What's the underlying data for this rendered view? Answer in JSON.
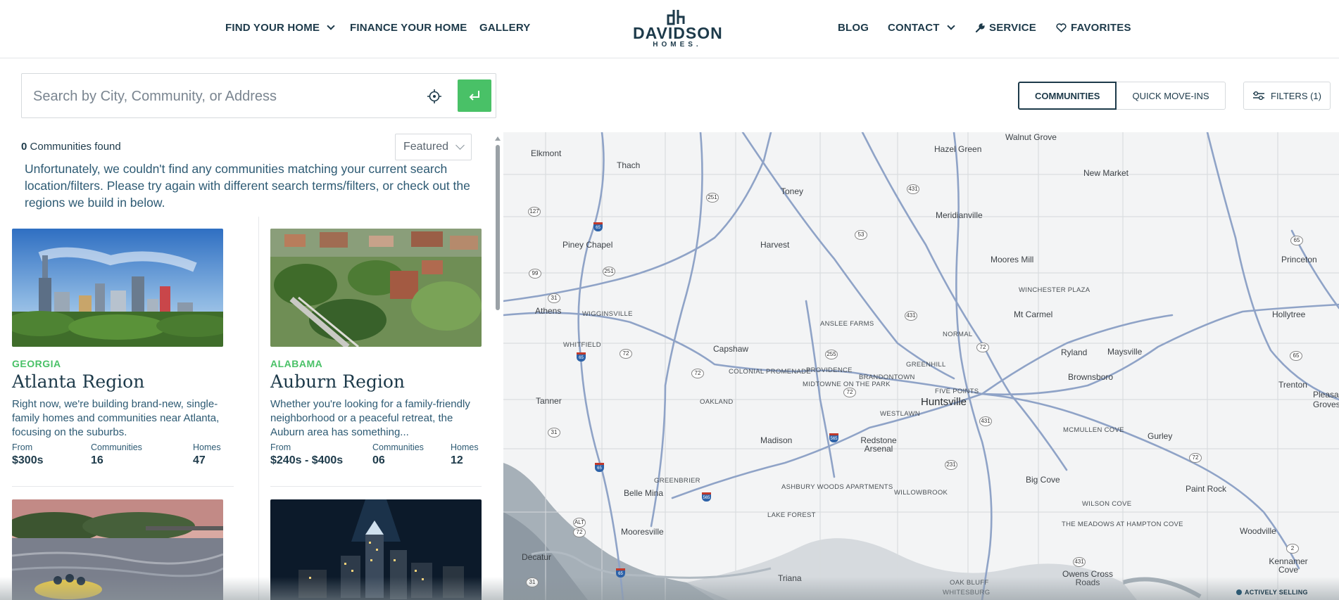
{
  "nav": {
    "left_items": [
      {
        "label": "FIND YOUR HOME",
        "has_dropdown": true
      },
      {
        "label": "FINANCE YOUR HOME",
        "has_dropdown": false
      },
      {
        "label": "GALLERY",
        "has_dropdown": false
      }
    ],
    "logo": {
      "name": "DAVIDSON",
      "sub": "HOMES."
    },
    "right_items": [
      {
        "label": "BLOG",
        "icon": ""
      },
      {
        "label": "CONTACT",
        "icon": "",
        "has_dropdown": true
      },
      {
        "label": "SERVICE",
        "icon": "wrench-icon"
      },
      {
        "label": "FAVORITES",
        "icon": "heart-icon"
      }
    ]
  },
  "search": {
    "placeholder": "Search by City, Community, or Address",
    "value": ""
  },
  "toggle": {
    "communities": "COMMUNITIES",
    "quick_move_ins": "QUICK MOVE-INS",
    "active": "communities"
  },
  "filters": {
    "label": "FILTERS (1)"
  },
  "results": {
    "count": "0",
    "count_label": "Communities found",
    "sort": "Featured",
    "message": "Unfortunately, we couldn't find any communities matching your current search location/filters. Please try again with different search terms/filters, or check out the regions we build in below."
  },
  "regions": [
    {
      "state": "GEORGIA",
      "title": "Atlanta Region",
      "desc": "Right now, we're building brand-new, single-family homes and communities near Atlanta, focusing on the suburbs.",
      "from_label": "From",
      "from": "$300s",
      "communities_label": "Communities",
      "communities": "16",
      "homes_label": "Homes",
      "homes": "47"
    },
    {
      "state": "ALABAMA",
      "title": "Auburn Region",
      "desc": "Whether you're looking for a family-friendly neighborhood or a peaceful retreat, the Auburn area has something...",
      "from_label": "From",
      "from": "$240s - $400s",
      "communities_label": "Communities",
      "communities": "06",
      "homes_label": "Homes",
      "homes": "12"
    }
  ],
  "map": {
    "labels": [
      "Walnut Grove",
      "Hazel Green",
      "Elkmont",
      "Thach",
      "New Market",
      "Toney",
      "Meridianville",
      "Piney Chapel",
      "Harvest",
      "Moores Mill",
      "Princeton",
      "Winchester Plaza",
      "Athens",
      "Wigginsville",
      "Ansleе Farms",
      "Mt Carmel",
      "Hollytree",
      "Normal",
      "Whitfield",
      "Capshaw",
      "Ryland",
      "Maysville",
      "Colonial Promenade",
      "Providence",
      "Greenhill",
      "Brownsboro",
      "Trenton",
      "Midtowne on the Park",
      "Brandontown",
      "Five Points",
      "Tanner",
      "Oakland",
      "Huntsville",
      "Westlawn",
      "Pleasant Groves",
      "McMullen Cove",
      "Gurley",
      "Madison",
      "Redstone Arsenal",
      "Greenbrier",
      "Big Cove",
      "Paint Rock",
      "Ashbury Woods Apartments",
      "Belle Mina",
      "Willowbrook",
      "Wilson Cove",
      "Lake Forest",
      "Mooresville",
      "The Meadows at Hampton Cove",
      "Woodville",
      "Decatur",
      "Kennamer Cove",
      "Triana",
      "Owens Cross Roads",
      "Oak Bluff",
      "Whitesburg"
    ],
    "status": "ACTIVELY SELLING"
  },
  "colors": {
    "brand_navy": "#1d3a4a",
    "accent_green": "#49c167",
    "road_blue": "#8fa3c7",
    "map_bg": "#f3f4f5"
  }
}
